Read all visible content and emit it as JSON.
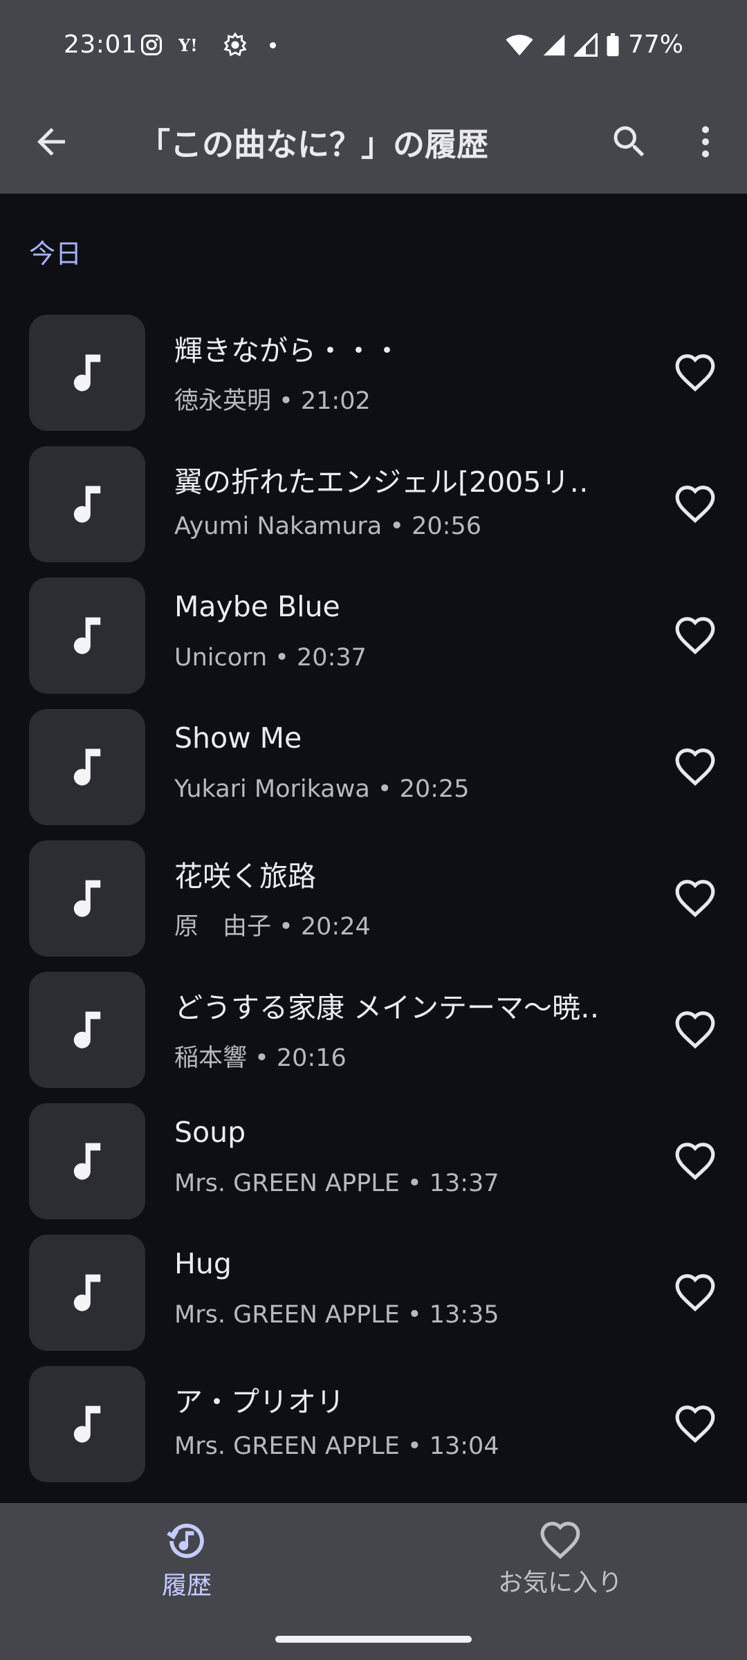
{
  "status_bar": {
    "time": "23:01",
    "battery_text": "77%",
    "left_icons": [
      "instagram-icon",
      "yahoo-icon",
      "app-notification-icon",
      "dot-icon"
    ],
    "right_icons": [
      "wifi-icon",
      "signal-icon",
      "signal-icon",
      "battery-icon"
    ]
  },
  "app_bar": {
    "title": "「この曲なに？」の履歴",
    "back_icon": "arrow-back-icon",
    "search_icon": "search-icon",
    "more_icon": "more-vert-icon"
  },
  "section": {
    "header": "今日"
  },
  "songs": [
    {
      "title": "輝きながら・・・",
      "subtitle": "徳永英明 • 21:02"
    },
    {
      "title": "翼の折れたエンジェル[2005リ‥",
      "subtitle": "Ayumi Nakamura • 20:56"
    },
    {
      "title": "Maybe Blue",
      "subtitle": "Unicorn • 20:37"
    },
    {
      "title": "Show Me",
      "subtitle": "Yukari Morikawa • 20:25"
    },
    {
      "title": "花咲く旅路",
      "subtitle": "原　由子 • 20:24"
    },
    {
      "title": "どうする家康 メインテーマ〜暁‥",
      "subtitle": "稲本響 • 20:16"
    },
    {
      "title": "Soup",
      "subtitle": "Mrs. GREEN APPLE • 13:37"
    },
    {
      "title": "Hug",
      "subtitle": "Mrs. GREEN APPLE • 13:35"
    },
    {
      "title": "ア・プリオリ",
      "subtitle": "Mrs. GREEN APPLE • 13:04"
    }
  ],
  "bottom_nav": {
    "history_label": "履歴",
    "favorites_label": "お気に入り"
  },
  "colors": {
    "bar": "#45464c",
    "background": "#0e0f14",
    "accent": "#a9b4f6",
    "thumb": "#2c2d33"
  }
}
